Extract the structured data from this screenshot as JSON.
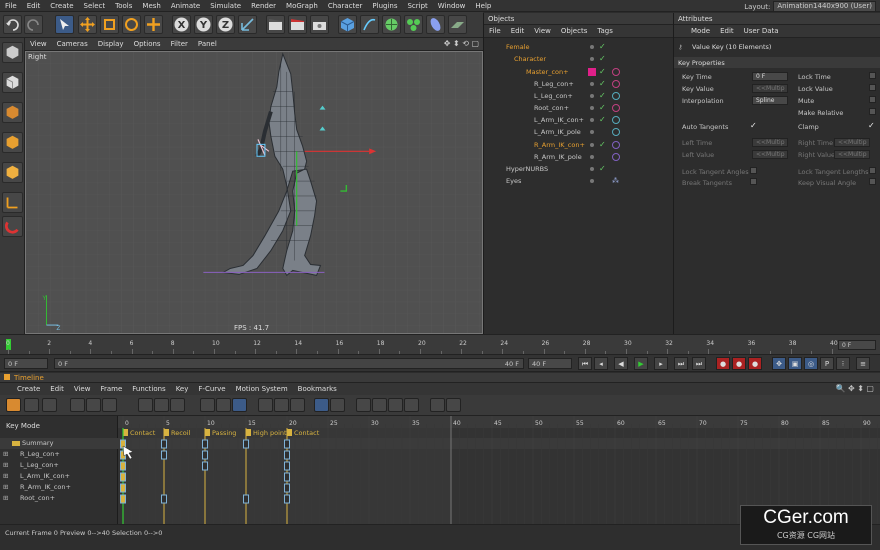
{
  "menubar": {
    "items": [
      "File",
      "Edit",
      "Create",
      "Select",
      "Tools",
      "Mesh",
      "Animate",
      "Simulate",
      "Render",
      "MoGraph",
      "Character",
      "Plugins",
      "Script",
      "Window",
      "Help"
    ],
    "layout_label": "Layout:",
    "layout_value": "Animation1440x900 (User)"
  },
  "viewport": {
    "menu": [
      "View",
      "Cameras",
      "Display",
      "Options",
      "Filter",
      "Panel"
    ],
    "label": "Right",
    "fps": "FPS : 41.7"
  },
  "objects": {
    "title": "Objects",
    "menu": [
      "File",
      "Edit",
      "View",
      "Objects",
      "Tags"
    ],
    "rows": [
      {
        "name": "Female",
        "color": "#e8a030"
      },
      {
        "name": "Character",
        "color": "#e8a030"
      },
      {
        "name": "Master_con+",
        "color": "#e8a030"
      },
      {
        "name": "R_Leg_con+",
        "color": "#c8c8c8"
      },
      {
        "name": "L_Leg_con+",
        "color": "#c8c8c8"
      },
      {
        "name": "Root_con+",
        "color": "#c8c8c8"
      },
      {
        "name": "L_Arm_IK_con+",
        "color": "#c8c8c8"
      },
      {
        "name": "L_Arm_IK_pole",
        "color": "#c8c8c8"
      },
      {
        "name": "R_Arm_IK_con+",
        "color": "#e8a030"
      },
      {
        "name": "R_Arm_IK_pole",
        "color": "#c8c8c8"
      },
      {
        "name": "HyperNURBS",
        "color": "#c8c8c8"
      },
      {
        "name": "Eyes",
        "color": "#c8c8c8"
      }
    ]
  },
  "attributes": {
    "title": "Attributes",
    "menu": [
      "Mode",
      "Edit",
      "User Data"
    ],
    "header": "Value Key (10 Elements)",
    "section": "Key Properties",
    "key_time_label": "Key Time",
    "key_time_value": "0 F",
    "lock_time": "Lock Time",
    "key_value_label": "Key Value",
    "key_value_value": "<<Multip",
    "lock_value": "Lock Value",
    "interp_label": "Interpolation",
    "interp_value": "Spline",
    "mute": "Mute",
    "make_relative": "Make Relative",
    "auto_tangents": "Auto Tangents",
    "clamp": "Clamp",
    "left_time": "Left Time",
    "left_time_value": "<<Multip",
    "right_time": "Right Time",
    "right_time_value": "<<Multip",
    "left_value": "Left Value",
    "left_value_value": "<<Multip",
    "right_value": "Right Value",
    "right_value_value": "<<Multip",
    "lock_tangent_angles": "Lock Tangent Angles",
    "lock_tangent_lengths": "Lock Tangent Lengths",
    "break_tangents": "Break Tangents",
    "keep_visual_angle": "Keep Visual Angle"
  },
  "ruler": {
    "ticks": [
      "0",
      "2",
      "4",
      "6",
      "8",
      "10",
      "12",
      "14",
      "16",
      "18",
      "20",
      "22",
      "24",
      "26",
      "28",
      "30",
      "32",
      "34",
      "36",
      "38",
      "40"
    ],
    "end_field": "0 F"
  },
  "transport": {
    "current": "0 F",
    "start": "0 F",
    "end": "40 F",
    "max": "40 F"
  },
  "timeline": {
    "title": "Timeline",
    "menu": [
      "Create",
      "Edit",
      "View",
      "Frame",
      "Functions",
      "Key",
      "F-Curve",
      "Motion System",
      "Bookmarks"
    ],
    "key_mode": "Key Mode",
    "ruler_ticks": [
      "0",
      "5",
      "10",
      "15",
      "20",
      "25",
      "30",
      "35",
      "40",
      "45",
      "50",
      "55",
      "60",
      "65",
      "70",
      "75",
      "80",
      "85",
      "90"
    ],
    "markers": [
      {
        "frame": 0,
        "label": "Contact"
      },
      {
        "frame": 5,
        "label": "Recoil"
      },
      {
        "frame": 10,
        "label": "Passing"
      },
      {
        "frame": 15,
        "label": "High point"
      },
      {
        "frame": 20,
        "label": "Contact"
      }
    ],
    "tracks": [
      "Summary",
      "R_Leg_con+",
      "L_Leg_con+",
      "L_Arm_IK_con+",
      "R_Arm_IK_con+",
      "Root_con+"
    ],
    "key_frames": [
      [
        0,
        5,
        10,
        15,
        20
      ],
      [
        0,
        5,
        10,
        20
      ],
      [
        0,
        10,
        20
      ],
      [
        0,
        20
      ],
      [
        0,
        20
      ],
      [
        0,
        5,
        15,
        20
      ]
    ]
  },
  "status": {
    "text": "Current Frame  0  Preview  0-->40     Selection 0-->0"
  },
  "watermark": {
    "main": "CGer.com",
    "sub": "CG资源  CG网站"
  },
  "colors": {
    "accent": "#3c5b88",
    "marker": "#d8b340",
    "key_blue": "#7fb3d8",
    "highlight_orange": "#e8a030"
  }
}
